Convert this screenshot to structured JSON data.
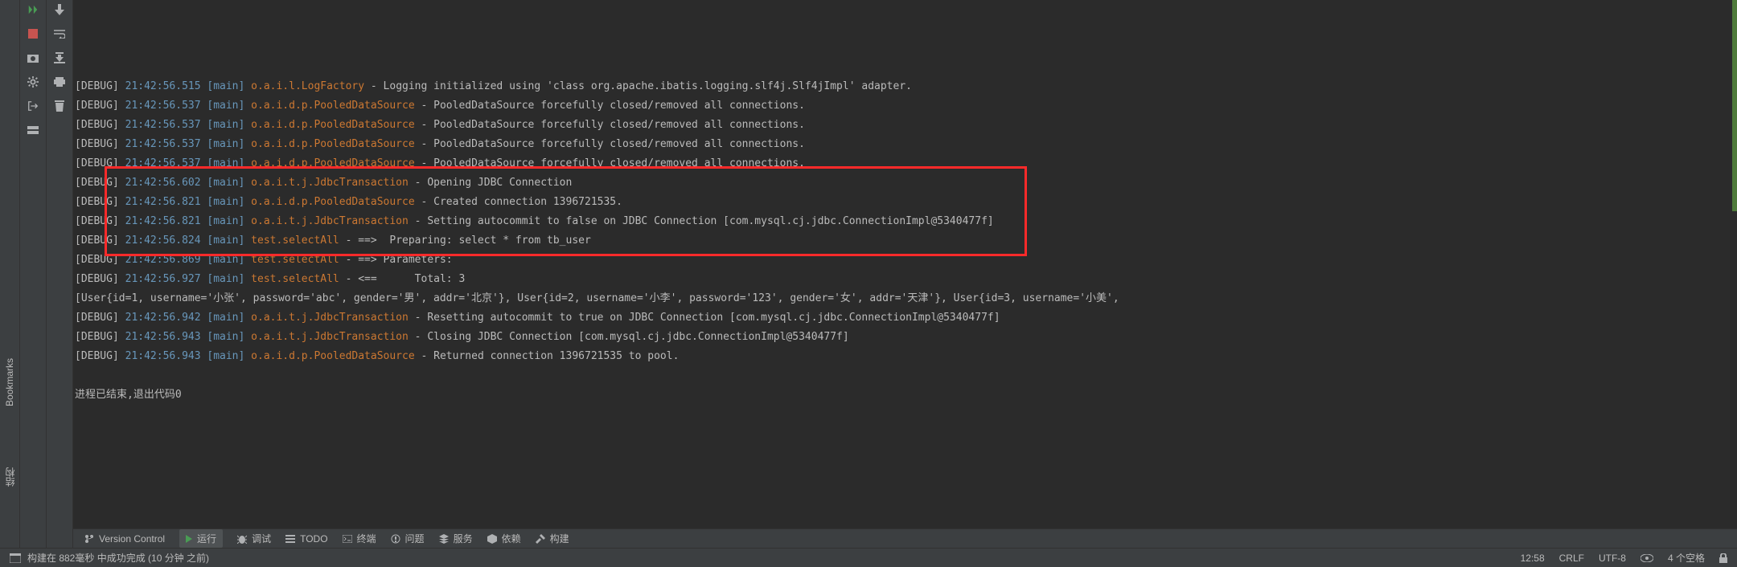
{
  "sidebar": {
    "bookmarks_label": "Bookmarks",
    "structure_label": "结构"
  },
  "log_lines": [
    {
      "level": "[DEBUG]",
      "time": "21:42:56.515",
      "thread": "[main]",
      "logger": "o.a.i.l.LogFactory",
      "logger_cls": "logger-oai",
      "msg": " - Logging initialized using 'class org.apache.ibatis.logging.slf4j.Slf4jImpl' adapter."
    },
    {
      "level": "[DEBUG]",
      "time": "21:42:56.537",
      "thread": "[main]",
      "logger": "o.a.i.d.p.PooledDataSource",
      "logger_cls": "logger-oai",
      "msg": " - PooledDataSource forcefully closed/removed all connections."
    },
    {
      "level": "[DEBUG]",
      "time": "21:42:56.537",
      "thread": "[main]",
      "logger": "o.a.i.d.p.PooledDataSource",
      "logger_cls": "logger-oai",
      "msg": " - PooledDataSource forcefully closed/removed all connections."
    },
    {
      "level": "[DEBUG]",
      "time": "21:42:56.537",
      "thread": "[main]",
      "logger": "o.a.i.d.p.PooledDataSource",
      "logger_cls": "logger-oai",
      "msg": " - PooledDataSource forcefully closed/removed all connections."
    },
    {
      "level": "[DEBUG]",
      "time": "21:42:56.537",
      "thread": "[main]",
      "logger": "o.a.i.d.p.PooledDataSource",
      "logger_cls": "logger-oai",
      "msg": " - PooledDataSource forcefully closed/removed all connections."
    },
    {
      "level": "[DEBUG]",
      "time": "21:42:56.602",
      "thread": "[main]",
      "logger": "o.a.i.t.j.JdbcTransaction",
      "logger_cls": "logger-oai",
      "msg": " - Opening JDBC Connection"
    },
    {
      "level": "[DEBUG]",
      "time": "21:42:56.821",
      "thread": "[main]",
      "logger": "o.a.i.d.p.PooledDataSource",
      "logger_cls": "logger-oai",
      "msg": " - Created connection 1396721535."
    },
    {
      "level": "[DEBUG]",
      "time": "21:42:56.821",
      "thread": "[main]",
      "logger": "o.a.i.t.j.JdbcTransaction",
      "logger_cls": "logger-oai",
      "msg": " - Setting autocommit to false on JDBC Connection [com.mysql.cj.jdbc.ConnectionImpl@5340477f]"
    },
    {
      "level": "[DEBUG]",
      "time": "21:42:56.824",
      "thread": "[main]",
      "logger": "test.selectAll",
      "logger_cls": "logger-test",
      "msg": " - ==>  Preparing: select * from tb_user"
    },
    {
      "level": "[DEBUG]",
      "time": "21:42:56.869",
      "thread": "[main]",
      "logger": "test.selectAll",
      "logger_cls": "logger-test",
      "msg": " - ==> Parameters: "
    },
    {
      "level": "[DEBUG]",
      "time": "21:42:56.927",
      "thread": "[main]",
      "logger": "test.selectAll",
      "logger_cls": "logger-test",
      "msg": " - <==      Total: 3"
    },
    {
      "plain": "[User{id=1, username='小张', password='abc', gender='男', addr='北京'}, User{id=2, username='小李', password='123', gender='女', addr='天津'}, User{id=3, username='小美',"
    },
    {
      "level": "[DEBUG]",
      "time": "21:42:56.942",
      "thread": "[main]",
      "logger": "o.a.i.t.j.JdbcTransaction",
      "logger_cls": "logger-oai",
      "msg": " - Resetting autocommit to true on JDBC Connection [com.mysql.cj.jdbc.ConnectionImpl@5340477f]"
    },
    {
      "level": "[DEBUG]",
      "time": "21:42:56.943",
      "thread": "[main]",
      "logger": "o.a.i.t.j.JdbcTransaction",
      "logger_cls": "logger-oai",
      "msg": " - Closing JDBC Connection [com.mysql.cj.jdbc.ConnectionImpl@5340477f]"
    },
    {
      "level": "[DEBUG]",
      "time": "21:42:56.943",
      "thread": "[main]",
      "logger": "o.a.i.d.p.PooledDataSource",
      "logger_cls": "logger-oai",
      "msg": " - Returned connection 1396721535 to pool."
    }
  ],
  "exit_line": "进程已结束,退出代码0",
  "bottom_tabs": {
    "vcs": "Version Control",
    "run": "运行",
    "debug": "调试",
    "todo": "TODO",
    "terminal": "终端",
    "problems": "问题",
    "services": "服务",
    "dependencies": "依赖",
    "build": "构建"
  },
  "statusbar": {
    "build_msg": "构建在 882毫秒 中成功完成 (10 分钟 之前)",
    "time": "12:58",
    "line_sep": "CRLF",
    "encoding": "UTF-8",
    "indent": "4 个空格"
  }
}
